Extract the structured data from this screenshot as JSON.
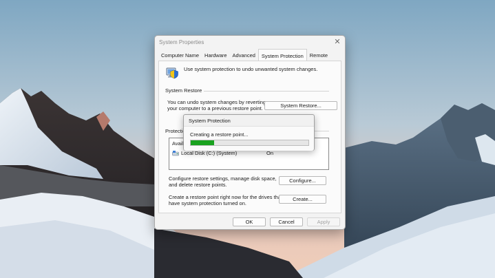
{
  "window": {
    "title": "System Properties",
    "close_glyph": "✕"
  },
  "tabs": [
    {
      "label": "Computer Name",
      "active": false
    },
    {
      "label": "Hardware",
      "active": false
    },
    {
      "label": "Advanced",
      "active": false
    },
    {
      "label": "System Protection",
      "active": true
    },
    {
      "label": "Remote",
      "active": false
    }
  ],
  "intro_text": "Use system protection to undo unwanted system changes.",
  "system_restore": {
    "heading": "System Restore",
    "description_line1": "You can undo system changes by reverting",
    "description_line2": "your computer to a previous restore point.",
    "button": "System Restore..."
  },
  "protection_settings": {
    "heading_partial": "Protectio",
    "column_header_partial": "Availa",
    "drive": {
      "name": "Local Disk (C:) (System)",
      "status": "On"
    }
  },
  "configure": {
    "line1": "Configure restore settings, manage disk space,",
    "line2": "and delete restore points.",
    "button": "Configure..."
  },
  "create": {
    "line1": "Create a restore point right now for the drives that",
    "line2": "have system protection turned on.",
    "button": "Create..."
  },
  "footer": {
    "ok": "OK",
    "cancel": "Cancel",
    "apply": "Apply"
  },
  "progress_dialog": {
    "title": "System Protection",
    "message": "Creating a restore point...",
    "progress": 0.2
  },
  "colors": {
    "progress_fill": "#19a21f",
    "shield_blue": "#2f6fd1",
    "shield_yellow": "#f3c517"
  },
  "icons": {
    "intro": "shield-computer-icon",
    "drive": "drive-icon",
    "close": "close-icon"
  }
}
